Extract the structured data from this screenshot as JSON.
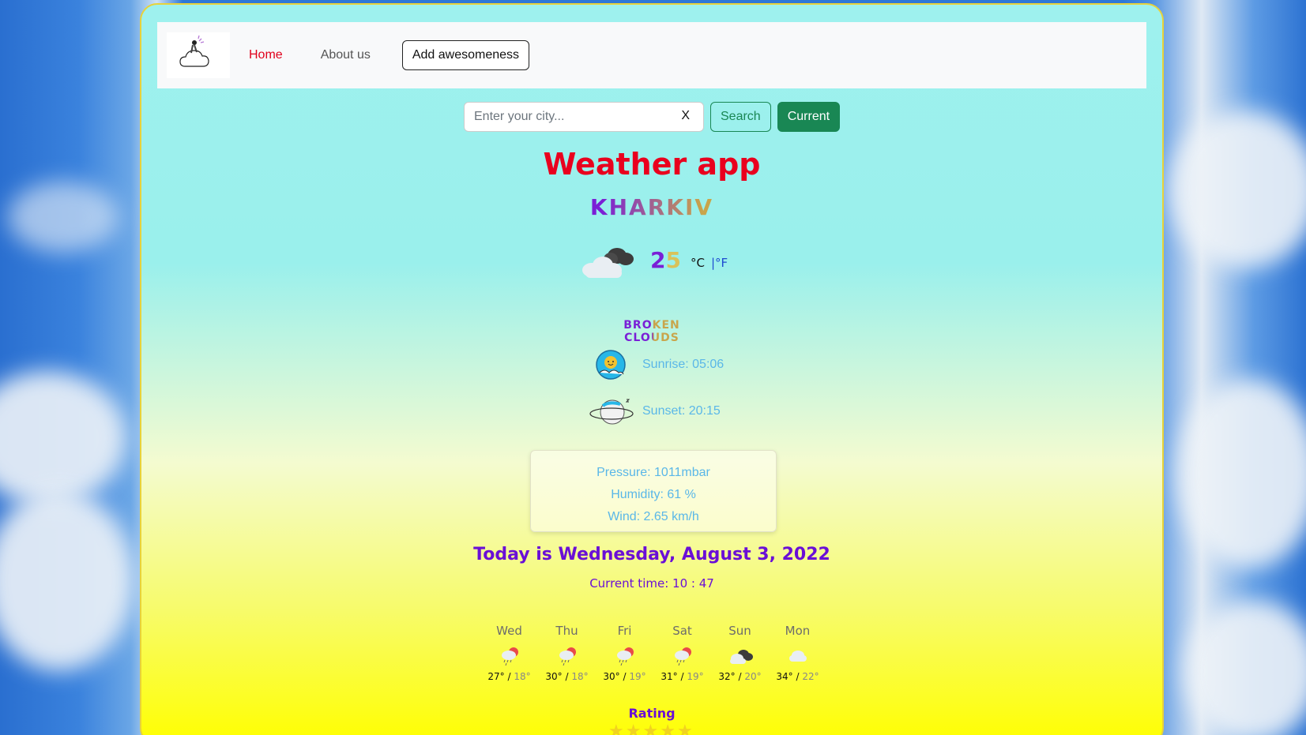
{
  "nav": {
    "home_label": "Home",
    "about_label": "About us",
    "awesome_label": "Add awesomeness",
    "logo_icon": "weather-logo-icon"
  },
  "search": {
    "placeholder": "Enter your city...",
    "value": "",
    "clear_label": "X",
    "search_label": "Search",
    "current_label": "Current"
  },
  "main": {
    "title": "Weather app",
    "city": "KHARKIV",
    "temperature": "25",
    "unit_c": "°C",
    "unit_f": "|°F",
    "weather_icon": "broken-clouds-icon",
    "description": "BROKEN CLOUDS",
    "sunrise": "Sunrise: 05:06",
    "sunset": "Sunset: 20:15"
  },
  "details": {
    "pressure": "Pressure: 1011mbar",
    "humidity": "Humidity: 61 %",
    "wind": "Wind: 2.65 km/h"
  },
  "date": {
    "today": "Today is Wednesday, August 3, 2022",
    "time": "Current time: 10 : 47"
  },
  "forecast": [
    {
      "day": "Wed",
      "max": "27°",
      "sep": " / ",
      "min": "18°",
      "icon": "rain-sun-icon"
    },
    {
      "day": "Thu",
      "max": "30°",
      "sep": " / ",
      "min": "18°",
      "icon": "rain-sun-icon"
    },
    {
      "day": "Fri",
      "max": "30°",
      "sep": " / ",
      "min": "19°",
      "icon": "rain-sun-icon"
    },
    {
      "day": "Sat",
      "max": "31°",
      "sep": " / ",
      "min": "19°",
      "icon": "rain-sun-icon"
    },
    {
      "day": "Sun",
      "max": "32°",
      "sep": " / ",
      "min": "20°",
      "icon": "broken-clouds-icon"
    },
    {
      "day": "Mon",
      "max": "34°",
      "sep": " / ",
      "min": "22°",
      "icon": "cloud-icon"
    }
  ],
  "rating": {
    "label": "Rating",
    "stars": 5
  },
  "colors": {
    "title": "#e9001e",
    "accent_purple": "#6a0fd6",
    "success": "#198754",
    "info_text": "#5ab7e8"
  }
}
